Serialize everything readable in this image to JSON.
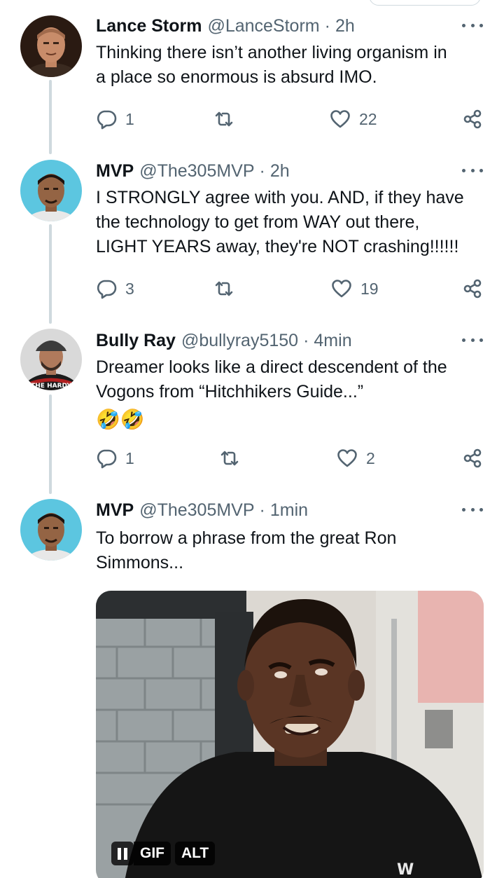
{
  "tweets": [
    {
      "name": "Lance Storm",
      "handle": "@LanceStorm",
      "time": "2h",
      "text_lines": [
        "Thinking there isn’t another living organism in",
        "a place so enormous is absurd IMO."
      ],
      "replies": "1",
      "reposts": "",
      "likes": "22"
    },
    {
      "name": "MVP",
      "handle": "@The305MVP",
      "time": "2h",
      "text_lines": [
        "I STRONGLY agree with you. AND, if they have",
        "the technology to get from WAY out there,",
        "LIGHT YEARS away, they're NOT crashing!!!!!!"
      ],
      "replies": "3",
      "reposts": "",
      "likes": "19"
    },
    {
      "name": "Bully Ray",
      "handle": "@bullyray5150",
      "time": "4min",
      "text_lines": [
        "Dreamer looks like a direct descendent of the",
        "Vogons from “Hitchhikers Guide...”"
      ],
      "emojis": "🤣🤣",
      "avatar_text": "THE HARDY",
      "replies": "1",
      "reposts": "",
      "likes": "2"
    },
    {
      "name": "MVP",
      "handle": "@The305MVP",
      "time": "1min",
      "text_lines": [
        "To borrow a phrase from the great Ron",
        "Simmons..."
      ]
    }
  ],
  "separator": "·",
  "media": {
    "gif_label": "GIF",
    "alt_label": "ALT"
  },
  "icons": {
    "reply": "speech-bubble-icon",
    "repost": "repost-arrows-icon",
    "like": "heart-icon",
    "share": "share-nodes-icon",
    "more": "more-dots-icon",
    "pause": "pause-icon"
  },
  "colors": {
    "text_primary": "#0f1419",
    "text_secondary": "#536471",
    "thread_line": "#cfd9de"
  }
}
